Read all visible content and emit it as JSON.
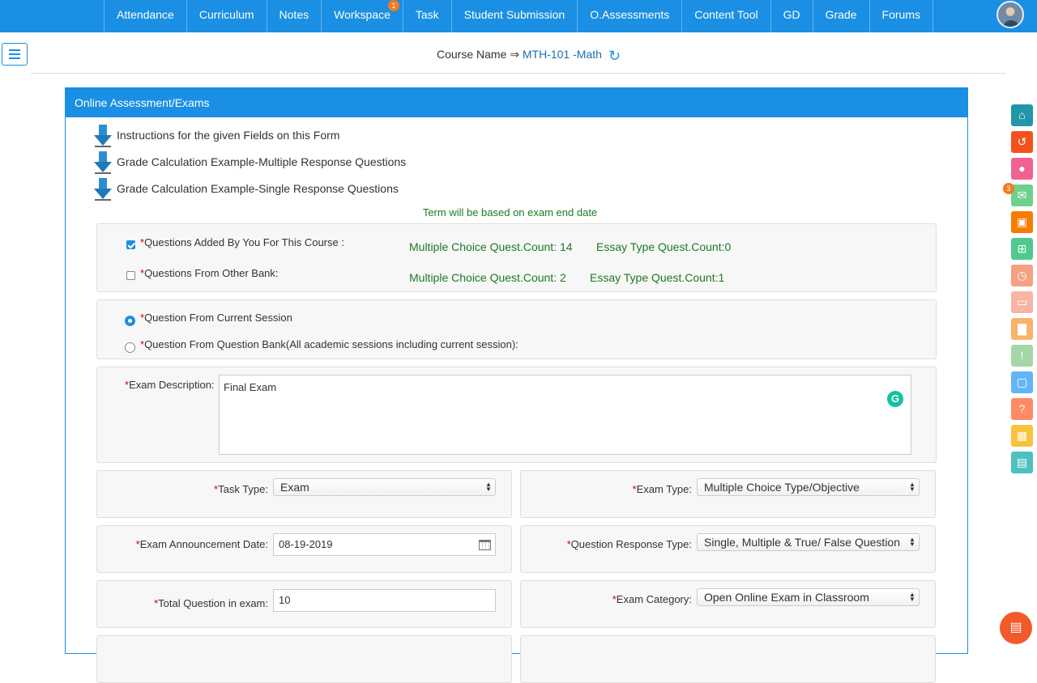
{
  "nav": {
    "tabs": [
      {
        "label": "Attendance"
      },
      {
        "label": "Curriculum"
      },
      {
        "label": "Notes"
      },
      {
        "label": "Workspace",
        "badge": "1"
      },
      {
        "label": "Task"
      },
      {
        "label": "Student Submission"
      },
      {
        "label": "O.Assessments"
      },
      {
        "label": "Content Tool"
      },
      {
        "label": "GD"
      },
      {
        "label": "Grade"
      },
      {
        "label": "Forums"
      }
    ]
  },
  "course": {
    "prefix": "Course Name ⇒ ",
    "name": "MTH-101 -Math"
  },
  "panel": {
    "title": "Online Assessment/Exams"
  },
  "instructions": [
    "Instructions for the given Fields on this Form",
    "Grade Calculation Example-Multiple Response Questions",
    "Grade Calculation Example-Single Response Questions"
  ],
  "term_note": "Term will be based on exam end date",
  "question_sources": {
    "own": {
      "label": "Questions Added By You For This Course :",
      "checked": true,
      "mcq_count": "Multiple Choice Quest.Count: 14",
      "essay_count": "Essay Type Quest.Count:0"
    },
    "other": {
      "label": "Questions From Other Bank:",
      "checked": false,
      "mcq_count": "Multiple Choice Quest.Count: 2",
      "essay_count": "Essay Type Quest.Count:1"
    }
  },
  "session": {
    "current": {
      "label": "Question From Current Session",
      "selected": true
    },
    "bank": {
      "label": "Question From Question Bank(All academic sessions including current session):",
      "selected": false
    }
  },
  "exam_description": {
    "label": "Exam Description:",
    "value": "Final Exam"
  },
  "fields": {
    "task_type": {
      "label": "Task Type:",
      "value": "Exam"
    },
    "exam_type": {
      "label": "Exam Type:",
      "value": "Multiple Choice Type/Objective"
    },
    "announcement_date": {
      "label": "Exam Announcement Date:",
      "value": "08-19-2019"
    },
    "response_type": {
      "label": "Question Response Type:",
      "value": "Single, Multiple & True/ False Question"
    },
    "total_questions": {
      "label": "Total Question in exam:",
      "value": "10"
    },
    "exam_category": {
      "label": "Exam Category:",
      "value": "Open Online Exam in Classroom"
    }
  },
  "required_mark": "*",
  "side_badge": "3",
  "colors": {
    "primary": "#1a8fe3",
    "green_text": "#1d7a23",
    "required": "#cc0000",
    "sidebar": [
      "#2196a8",
      "#f4511e",
      "#f06292",
      "#6fd08c",
      "#f57c00",
      "#4fc98c",
      "#f4a183",
      "#f9b4a3",
      "#f8b26a",
      "#a5d6a7",
      "#64b5f6",
      "#ff8a65",
      "#f9c23c",
      "#4dc0c0"
    ]
  },
  "sidebar_icons": [
    "home-icon",
    "refresh-icon",
    "profile-icon",
    "mail-icon",
    "contact-card-icon",
    "monitor-add-icon",
    "clock-icon",
    "card-icon",
    "bar-chart-icon",
    "alert-icon",
    "folder-icon",
    "help-icon",
    "calendar-icon",
    "book-icon"
  ]
}
